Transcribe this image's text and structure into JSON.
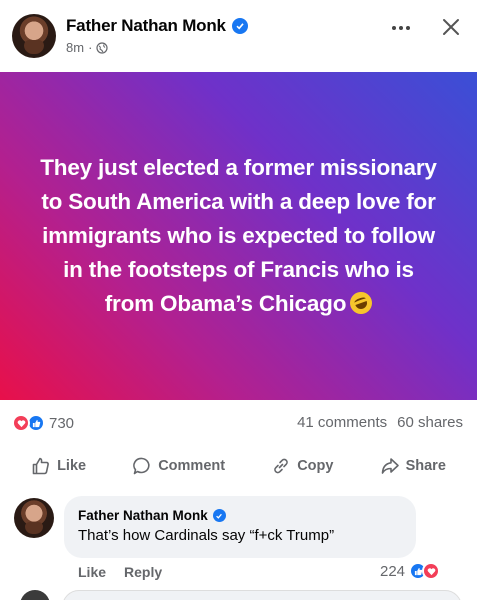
{
  "post": {
    "author": "Father Nathan Monk",
    "time": "8m",
    "text": "They just elected a former missionary to South America with a deep love for immigrants who is expected to follow in the footsteps of Francis who is from Obama’s Chicago",
    "reaction_count": "730",
    "comments_count": "41 comments",
    "shares_count": "60 shares"
  },
  "actions": {
    "like": "Like",
    "comment": "Comment",
    "copy": "Copy",
    "share": "Share"
  },
  "comment": {
    "author": "Father Nathan Monk",
    "text": "That’s how Cardinals say “f+ck Trump”",
    "like": "Like",
    "reply": "Reply",
    "reaction_count": "224"
  },
  "colors": {
    "facebook_blue": "#1877f2",
    "love_red": "#f33e58",
    "muted_text": "#65676b"
  }
}
